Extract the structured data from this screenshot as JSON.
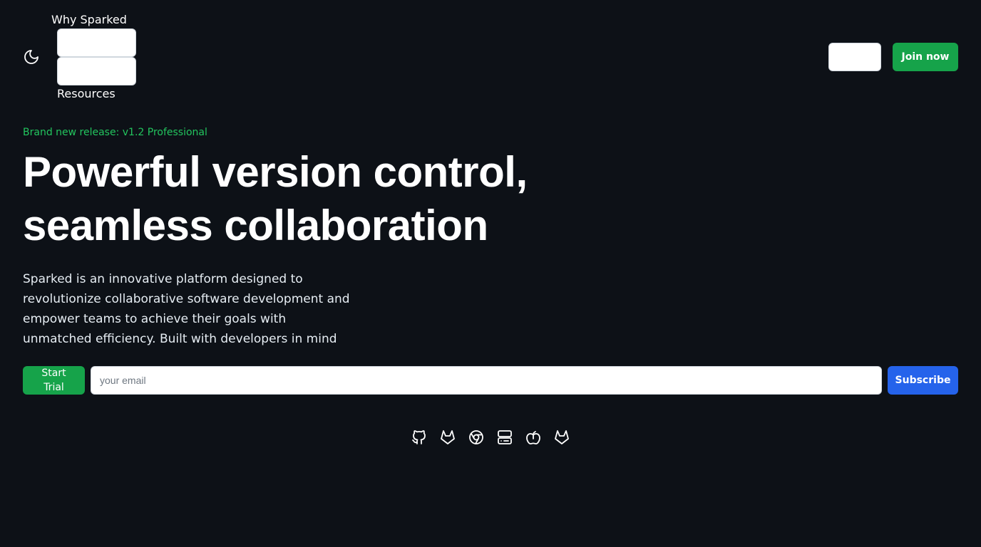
{
  "nav": {
    "theme_toggle_icon": "moon-icon",
    "top_link": "Why Sparked",
    "bottom_link": "Resources"
  },
  "header": {
    "join_label": "Join now"
  },
  "hero": {
    "release_badge": "Brand new release: v1.2 Professional",
    "title_line1": "Powerful version control,",
    "title_line2": "seamless collaboration",
    "description": "Sparked is an innovative platform designed to revolutionize collaborative software development and empower teams to achieve their goals with unmatched efficiency. Built with developers in mind"
  },
  "signup": {
    "trial_label": "Start Trial",
    "email_placeholder": "your email",
    "email_value": "",
    "subscribe_label": "Subscribe"
  },
  "platform_icons": [
    "github-icon",
    "gitlab-icon",
    "chrome-icon",
    "server-icon",
    "apple-icon",
    "gitlab-icon"
  ],
  "colors": {
    "background": "#0d1117",
    "accent_green": "#16a34a",
    "badge_green": "#22c55e",
    "accent_blue": "#2563eb"
  }
}
